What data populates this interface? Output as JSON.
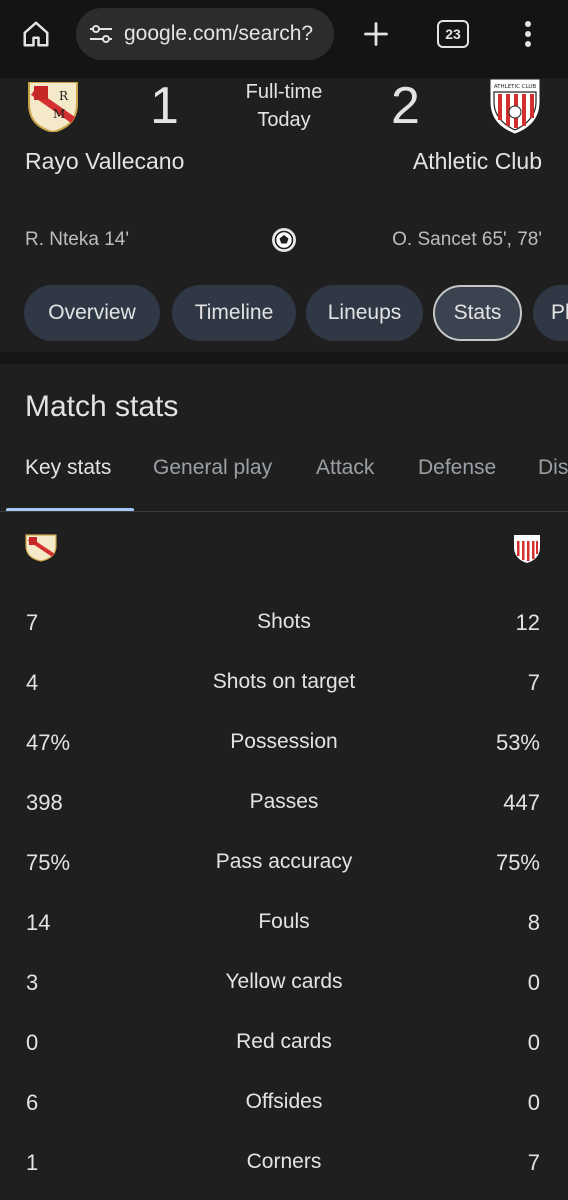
{
  "browser": {
    "url": "google.com/search?",
    "tab_count": "23"
  },
  "match": {
    "status_line1": "Full-time",
    "status_line2": "Today",
    "home": {
      "name": "Rayo Vallecano",
      "score": "1",
      "scorers": "R. Nteka 14'"
    },
    "away": {
      "name": "Athletic Club",
      "score": "2",
      "scorers": "O. Sancet 65', 78'"
    },
    "away_crest_text": "ATHLETIC CLUB"
  },
  "tabs": [
    "Overview",
    "Timeline",
    "Lineups",
    "Stats",
    "Pl"
  ],
  "stats": {
    "title": "Match stats",
    "subtabs": [
      "Key stats",
      "General play",
      "Attack",
      "Defense",
      "Dis"
    ],
    "rows": [
      {
        "label": "Shots",
        "home": "7",
        "away": "12"
      },
      {
        "label": "Shots on target",
        "home": "4",
        "away": "7"
      },
      {
        "label": "Possession",
        "home": "47%",
        "away": "53%"
      },
      {
        "label": "Passes",
        "home": "398",
        "away": "447"
      },
      {
        "label": "Pass accuracy",
        "home": "75%",
        "away": "75%"
      },
      {
        "label": "Fouls",
        "home": "14",
        "away": "8"
      },
      {
        "label": "Yellow cards",
        "home": "3",
        "away": "0"
      },
      {
        "label": "Red cards",
        "home": "0",
        "away": "0"
      },
      {
        "label": "Offsides",
        "home": "6",
        "away": "0"
      },
      {
        "label": "Corners",
        "home": "1",
        "away": "7"
      }
    ]
  }
}
